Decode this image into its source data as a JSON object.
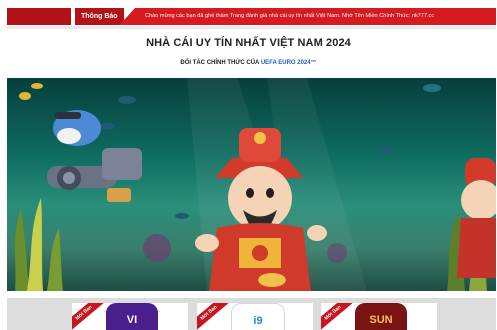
{
  "notice": {
    "label": "Thông Báo",
    "text": "Chào mừng các bạn đã ghé thăm Trang đánh giá nhà cái uy tín nhất Việt Nam. Nhớ Tên Miền Chính Thức: nk777.cc"
  },
  "header": {
    "title": "NHÀ CÁI UY TÍN NHẤT VIỆT NAM 2024",
    "subtitle_prefix": "ĐỐI TÁC CHÍNH THỨC CỦA ",
    "subtitle_highlight": "UEFA EURO 2024™"
  },
  "apps": [
    {
      "ribbon": "Mới Ban",
      "logo_text": "VI",
      "color": "#4a1f8c"
    },
    {
      "ribbon": "Mới Ban",
      "logo_text": "i9",
      "color": "#1e88e5"
    },
    {
      "ribbon": "Mới Ban",
      "logo_text": "SUN",
      "color": "#7a1414"
    }
  ],
  "colors": {
    "notice_bg": "#d71920",
    "highlight": "#1e5fc9"
  }
}
